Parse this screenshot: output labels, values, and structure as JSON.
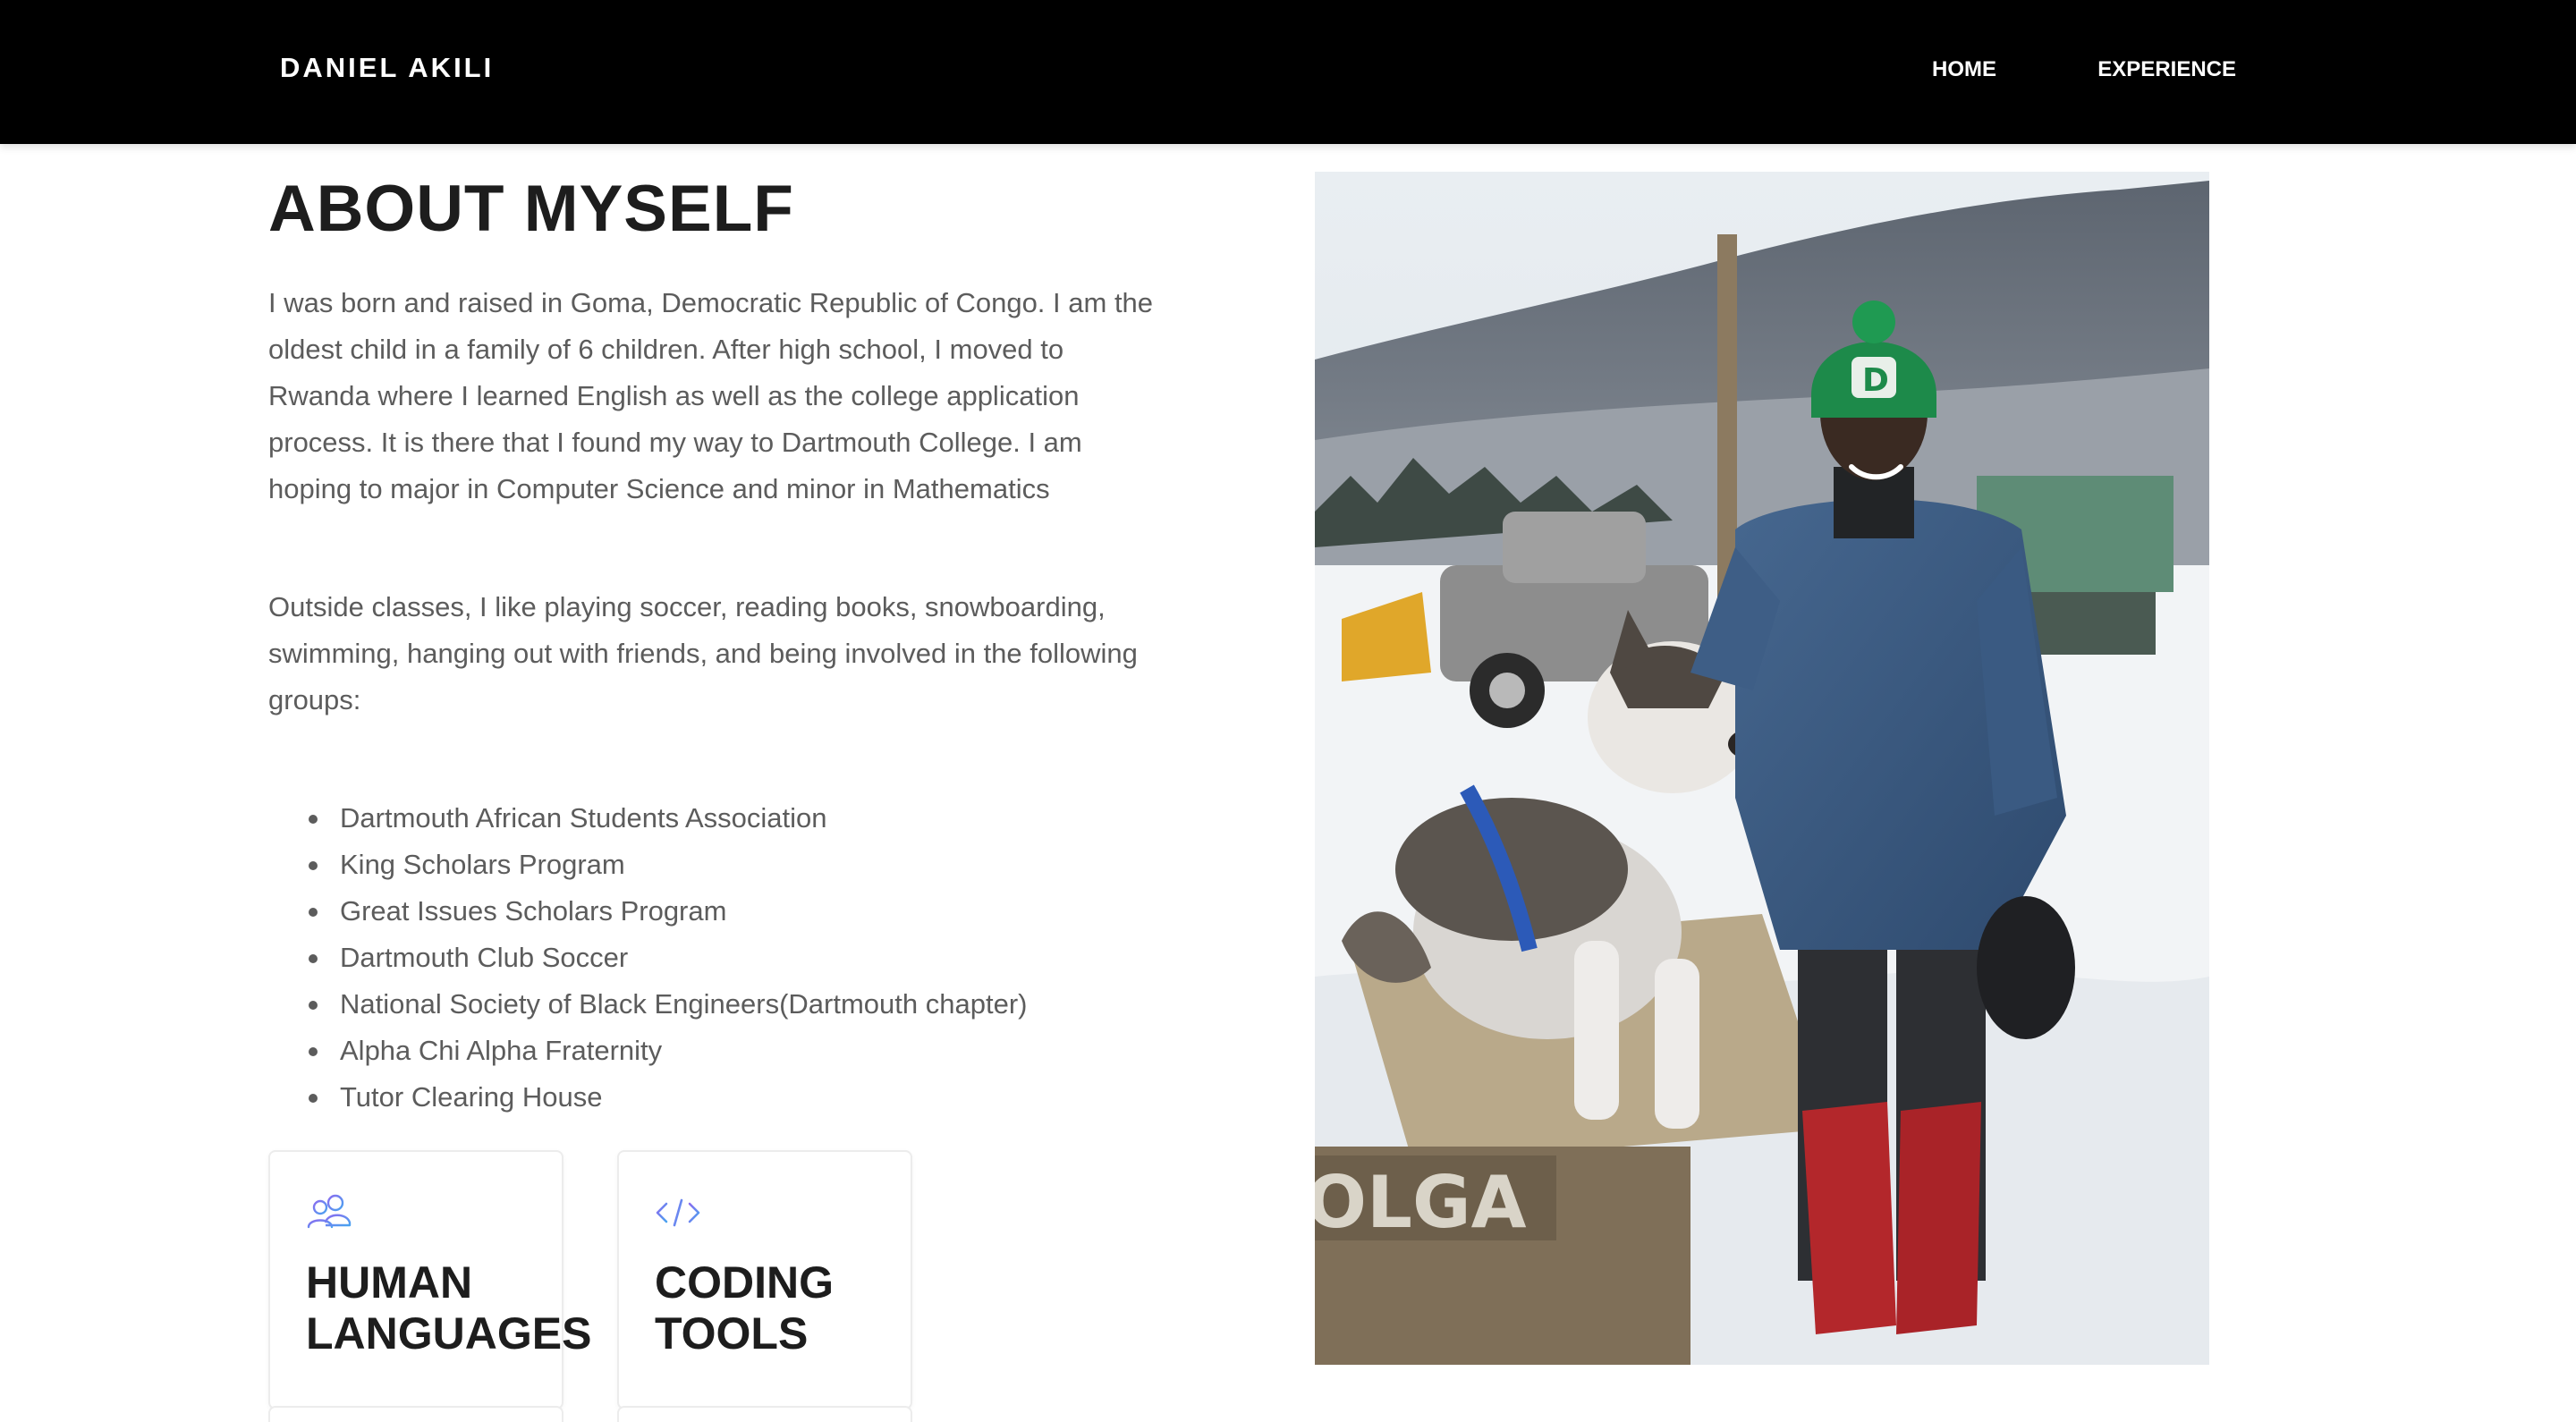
{
  "header": {
    "brand": "DANIEL AKILI",
    "nav": [
      {
        "label": "HOME"
      },
      {
        "label": "EXPERIENCE"
      }
    ]
  },
  "about": {
    "title": "ABOUT MYSELF",
    "paragraph1": "I was born and raised in Goma, Democratic Republic of Congo. I am the oldest child in a family of 6 children. After high school, I moved to Rwanda where I learned English as well as the college application process. It is there that I found my way to Dartmouth College. I am hoping to major in Computer Science and minor in Mathematics",
    "paragraph2": "Outside classes, I like playing soccer, reading books, snowboarding, swimming, hanging out with friends, and being involved in the following groups:",
    "groups": [
      "Dartmouth African Students Association",
      "King Scholars Program",
      "Great Issues Scholars Program",
      "Dartmouth Club Soccer",
      "National Society of Black Engineers(Dartmouth chapter)",
      "Alpha Chi Alpha Fraternity",
      "Tutor Clearing House"
    ]
  },
  "cards": [
    {
      "title": "HUMAN LANGUAGES",
      "icon": "people-icon"
    },
    {
      "title": "CODING TOOLS",
      "icon": "code-icon"
    }
  ],
  "photo": {
    "sign_text": "OLGA",
    "hat_letter": "D"
  },
  "colors": {
    "header_bg": "#000000",
    "heading": "#1d1d1d",
    "body_text": "#5c5c5c",
    "icon_accent": "#5b8def"
  }
}
